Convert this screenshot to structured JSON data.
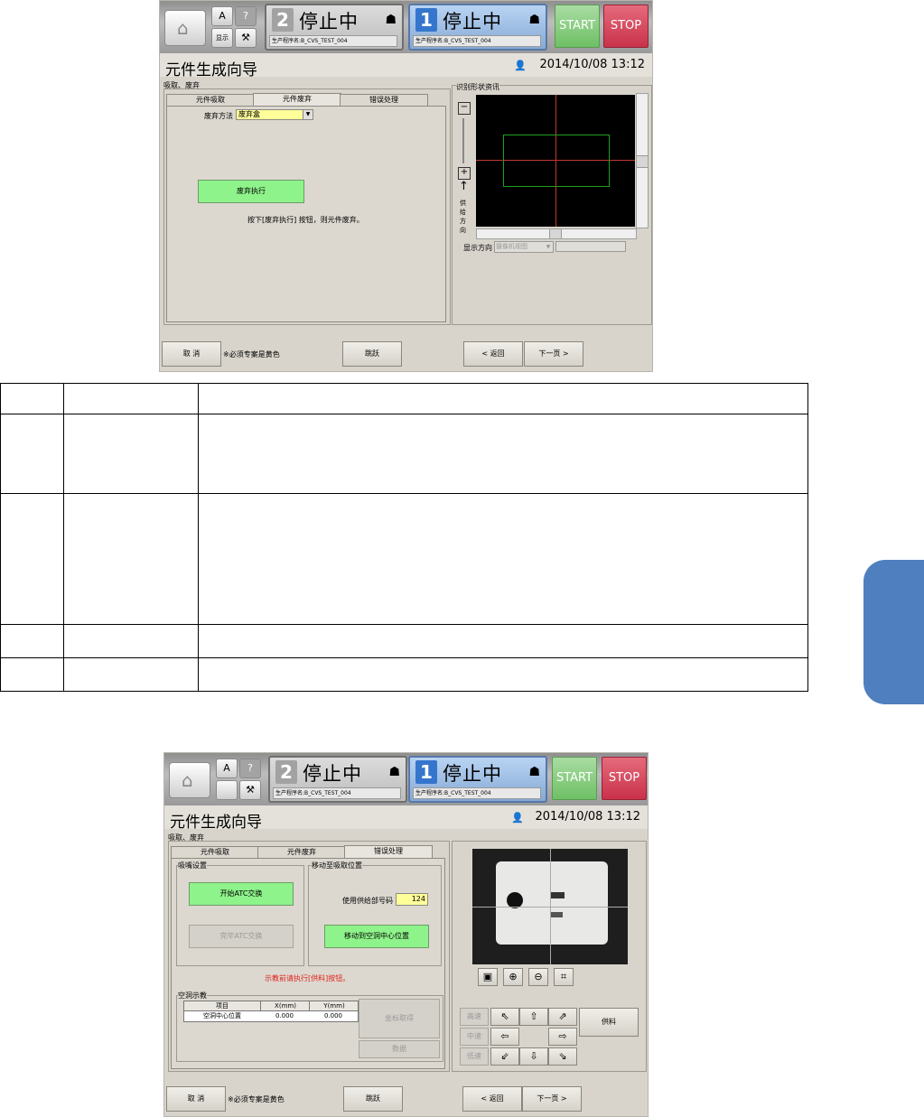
{
  "screen1": {
    "header": {
      "lanes": [
        {
          "number": "2",
          "status": "停止中",
          "program": "生产程序名:B_CVS_TEST_004"
        },
        {
          "number": "1",
          "status": "停止中",
          "program": "生产程序名:B_CVS_TEST_004"
        }
      ],
      "start_label": "START",
      "stop_label": "STOP",
      "small_labels": [
        "A",
        "?",
        "显示",
        ""
      ]
    },
    "title": "元件生成向导",
    "datetime": "2014/10/08 13:12",
    "section": "吸取、废弃",
    "tabs": [
      "元件吸取",
      "元件废弃",
      "错误处理"
    ],
    "discard_method_label": "废弃方法",
    "discard_method_value": "废弃盒",
    "discard_exec_button": "废弃执行",
    "discard_hint": "按下[废弃执行] 按钮，则元件废弃。",
    "shape_info_title": "识别形状资讯",
    "feed_direction": [
      "供",
      "给",
      "方",
      "向"
    ],
    "display_direction_label": "显示方向",
    "display_direction_value": "摄像机视图",
    "footer": {
      "cancel": "取 消",
      "required_note": "※必须专案是黄色",
      "skip": "跳跃",
      "back": "< 返回",
      "next": "下一页 >"
    }
  },
  "screen2": {
    "header": {
      "lanes": [
        {
          "number": "2",
          "status": "停止中",
          "program": "生产程序名:B_CVS_TEST_004"
        },
        {
          "number": "1",
          "status": "停止中",
          "program": "生产程序名:B_CVS_TEST_004"
        }
      ],
      "start_label": "START",
      "stop_label": "STOP"
    },
    "title": "元件生成向导",
    "datetime": "2014/10/08 13:12",
    "section": "吸取、废弃",
    "tabs": [
      "元件吸取",
      "元件废弃",
      "错误处理"
    ],
    "nozzle_group": "吸嘴设置",
    "start_atc": "开始ATC交换",
    "finish_atc": "完毕ATC交换",
    "move_group": "移动至吸取位置",
    "feeder_no_label": "使用供给部号码",
    "feeder_no_value": "124",
    "move_center": "移动到空洞中心位置",
    "warning": "示教前请执行[供料]按钮。",
    "teach_group": "空洞示教",
    "teach_headers": [
      "项目",
      "X(mm)",
      "Y(mm)"
    ],
    "teach_row": [
      "空洞中心位置",
      "0.000",
      "0.000"
    ],
    "get_coords": "坐标取得",
    "data_btn": "数据",
    "speeds": [
      "高速",
      "中速",
      "低速"
    ],
    "feed_button": "供料",
    "footer": {
      "cancel": "取 消",
      "required_note": "※必须专案是黄色",
      "skip": "跳跃",
      "back": "< 返回",
      "next": "下一页 >"
    }
  }
}
